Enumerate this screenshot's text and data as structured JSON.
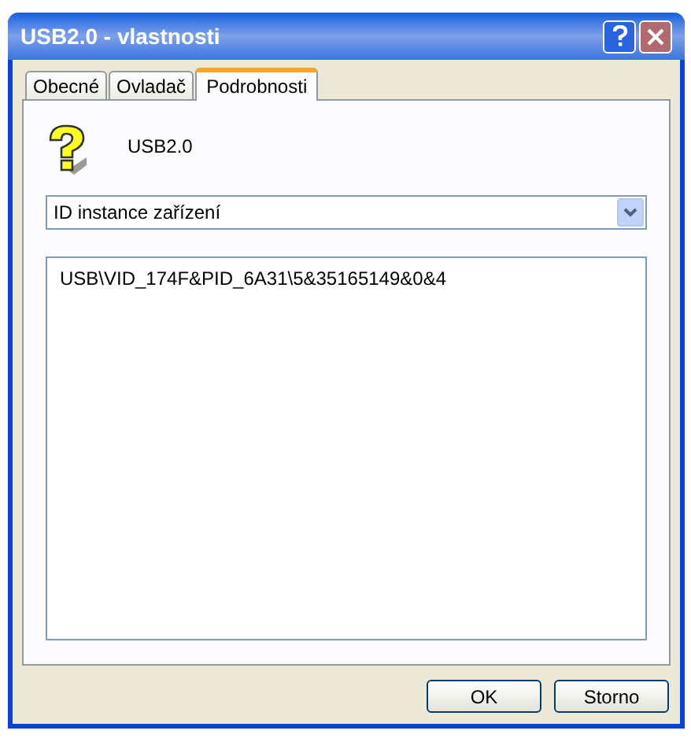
{
  "window": {
    "title": "USB2.0 - vlastnosti"
  },
  "tabs": [
    {
      "label": "Obecné",
      "selected": false
    },
    {
      "label": "Ovladač",
      "selected": false
    },
    {
      "label": "Podrobnosti",
      "selected": true
    }
  ],
  "device": {
    "name": "USB2.0"
  },
  "property_dropdown": {
    "value": "ID instance zařízení"
  },
  "values_list": {
    "items": [
      "USB\\VID_174F&PID_6A31\\5&35165149&0&4"
    ]
  },
  "buttons": [
    "OK",
    "Storno"
  ]
}
